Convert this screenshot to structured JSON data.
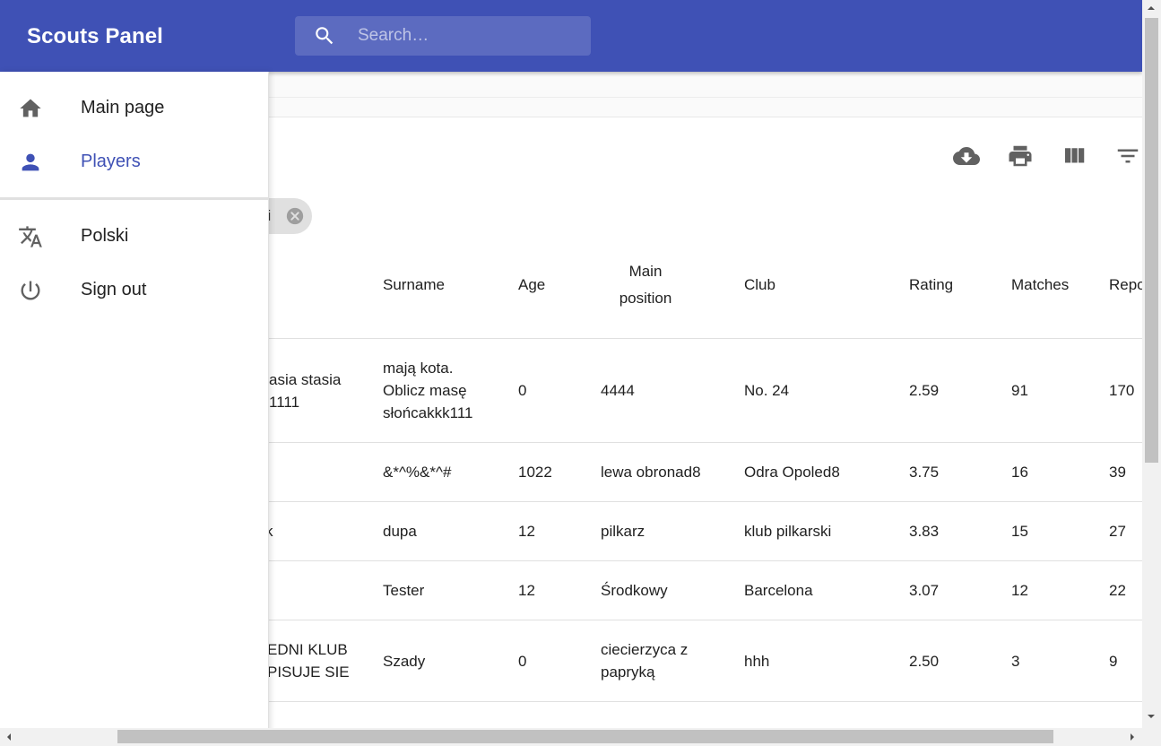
{
  "app": {
    "title": "Scouts Panel"
  },
  "search": {
    "placeholder": "Search…",
    "icon": "search-icon"
  },
  "drawer": {
    "items": [
      {
        "label": "Main page",
        "icon": "home-icon",
        "active": false
      },
      {
        "label": "Players",
        "icon": "person-icon",
        "active": true
      }
    ],
    "secondary": [
      {
        "label": "Polski",
        "icon": "translate-icon"
      },
      {
        "label": "Sign out",
        "icon": "power-icon"
      }
    ]
  },
  "toolbar": {
    "icons": [
      "download-icon",
      "print-icon",
      "view-column-icon",
      "filter-icon"
    ]
  },
  "filter_chip": {
    "label": "ki"
  },
  "table": {
    "headers": {
      "name_partial": "",
      "surname": "Surname",
      "age": "Age",
      "main_position": "Main\nposition",
      "club": "Club",
      "rating": "Rating",
      "matches": "Matches",
      "reports": "Repo"
    },
    "rows": [
      {
        "name": "asia stasia\n1111",
        "surname": "mają kota.\nOblicz masę\nsłońcakkk111",
        "age": "0",
        "position": "4444",
        "club": "No. 24",
        "rating": "2.59",
        "matches": "91",
        "reports": "170"
      },
      {
        "name": "",
        "surname": "&*^%&*^#",
        "age": "1022",
        "position": "lewa obronad8",
        "club": "Odra Opoled8",
        "rating": "3.75",
        "matches": "16",
        "reports": "39"
      },
      {
        "name": "k",
        "surname": "dupa",
        "age": "12",
        "position": "pilkarz",
        "club": "klub pilkarski",
        "rating": "3.83",
        "matches": "15",
        "reports": "27"
      },
      {
        "name": "",
        "surname": "Tester",
        "age": "12",
        "position": "Środkowy",
        "club": "Barcelona",
        "rating": "3.07",
        "matches": "12",
        "reports": "22"
      },
      {
        "name": "EDNI KLUB\nPISUJE SIE",
        "surname": "Szady",
        "age": "0",
        "position": "ciecierzyca z\npapryką",
        "club": "hhh",
        "rating": "2.50",
        "matches": "3",
        "reports": "9"
      }
    ]
  },
  "colors": {
    "primary": "#3f51b5",
    "search_bg": "#5c6bc0",
    "active_text": "#3f51b5"
  }
}
